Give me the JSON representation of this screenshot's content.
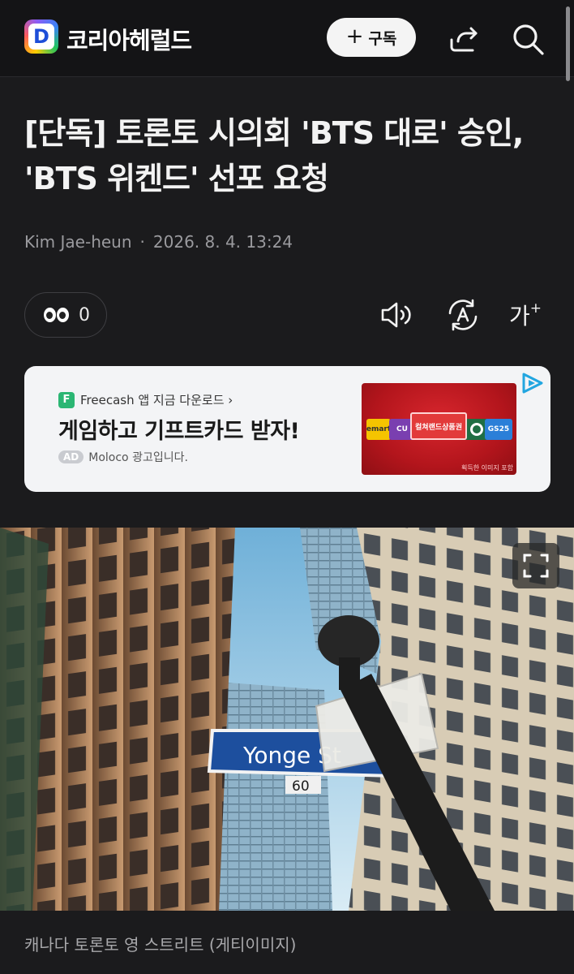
{
  "header": {
    "logo_letter": "D",
    "brand": "코리아헤럴드",
    "subscribe_label": "구독",
    "subscribe_plus": "+"
  },
  "article": {
    "title": "[단독] 토론토 시의회 'BTS 대로' 승인, 'BTS 위켄드' 선포 요청",
    "author": "Kim Jae-heun",
    "separator": "·",
    "datetime": "2026. 8. 4. 13:24"
  },
  "toolbar": {
    "reaction_count": "0",
    "font_label": "가",
    "font_plus": "+"
  },
  "ad": {
    "source_badge": "F",
    "source": "Freecash 앱 지금 다운로드 ›",
    "headline": "게임하고 기프트카드 받자!",
    "ad_tag": "AD",
    "note": "Moloco 광고입니다.",
    "card_labels": [
      "emart",
      "CU",
      "컬쳐랜드상품권",
      "",
      "GS25"
    ],
    "fine_print": "획득한 이미지 포함"
  },
  "photo": {
    "sign_text": "Yonge St",
    "sign_number": "60",
    "caption": "캐나다 토론토 영 스트리트 (게티이미지)"
  },
  "colors": {
    "background": "#1b1b1d",
    "header": "#141416",
    "ad_background": "#f3f4f6",
    "freecash_green": "#2bb673",
    "sign_blue": "#1d4f9e"
  },
  "icons": [
    "share-icon",
    "search-icon",
    "eyes-emoji-icon",
    "text-to-speech-icon",
    "translate-icon",
    "font-size-icon",
    "ad-choices-icon",
    "fullscreen-expand-icon"
  ]
}
